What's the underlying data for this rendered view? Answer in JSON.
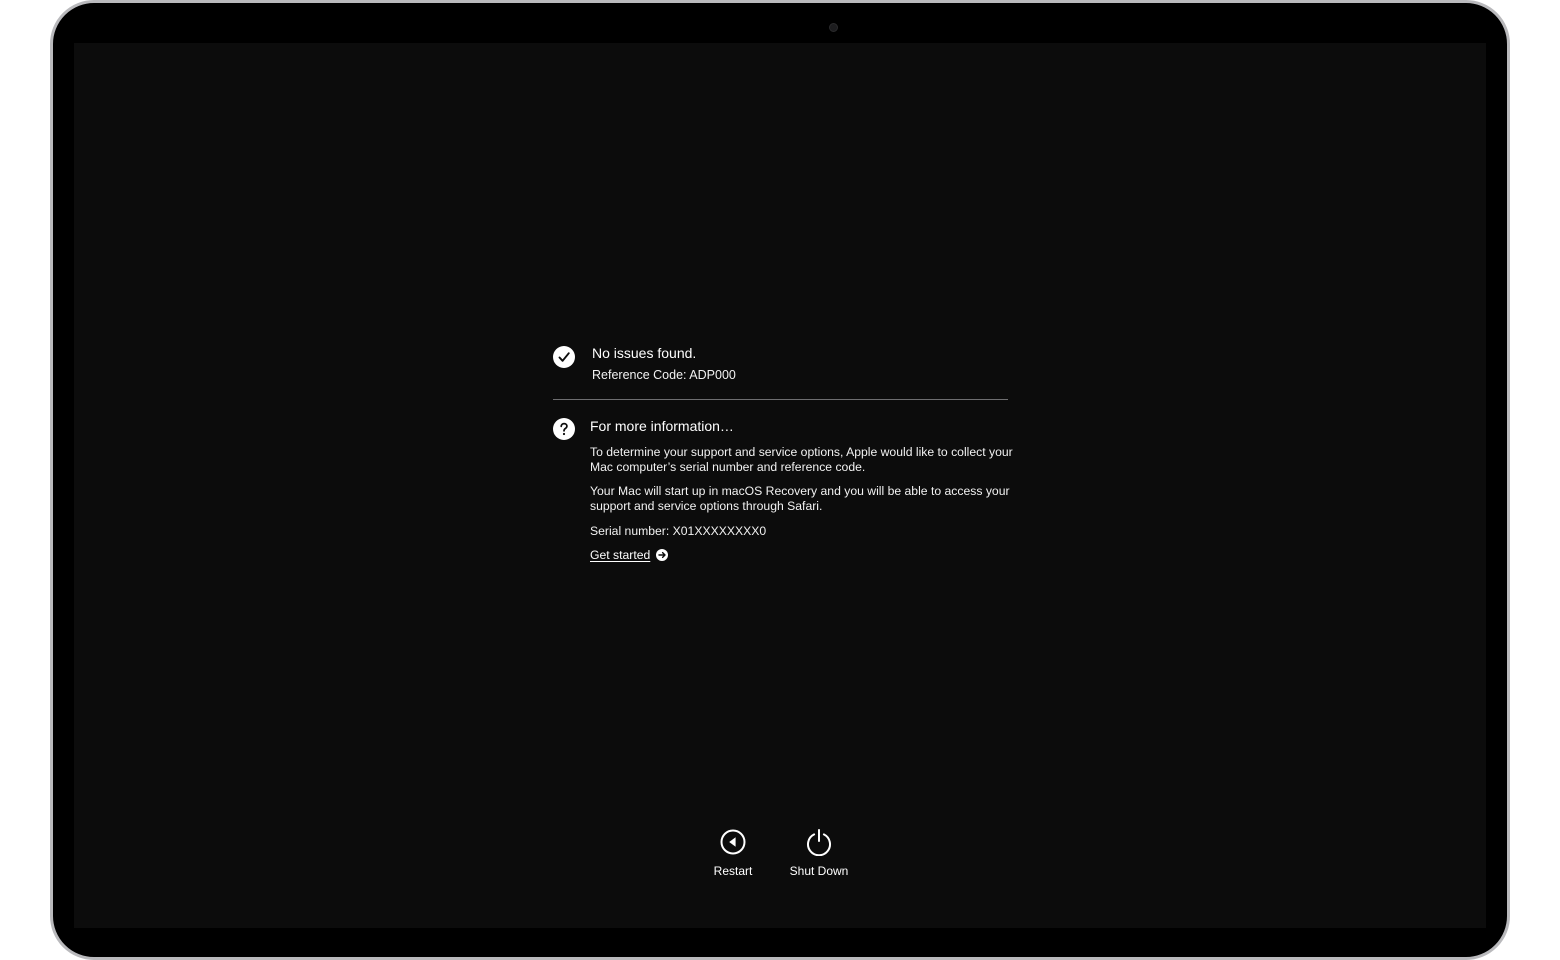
{
  "status": {
    "title": "No issues found.",
    "reference": "Reference Code: ADP000"
  },
  "info": {
    "title": "For more information…",
    "paragraph1": "To determine your support and service options, Apple would like to collect your Mac computer’s serial number and reference code.",
    "paragraph2": "Your Mac will start up in macOS Recovery and you will be able to access your support and service options through Safari.",
    "serial": "Serial number: X01XXXXXXXX0",
    "get_started": "Get started"
  },
  "actions": {
    "restart_label": "Restart",
    "shutdown_label": "Shut Down"
  },
  "icons": {
    "status": "checkmark-circle-icon",
    "info": "question-circle-icon",
    "get_started": "arrow-right-circle-icon",
    "restart": "restart-arrow-icon",
    "shutdown": "power-icon"
  },
  "colors": {
    "screen_background": "#0c0c0c",
    "text": "#ffffff",
    "divider": "#6e6e70",
    "frame": "#b9b9bc"
  }
}
